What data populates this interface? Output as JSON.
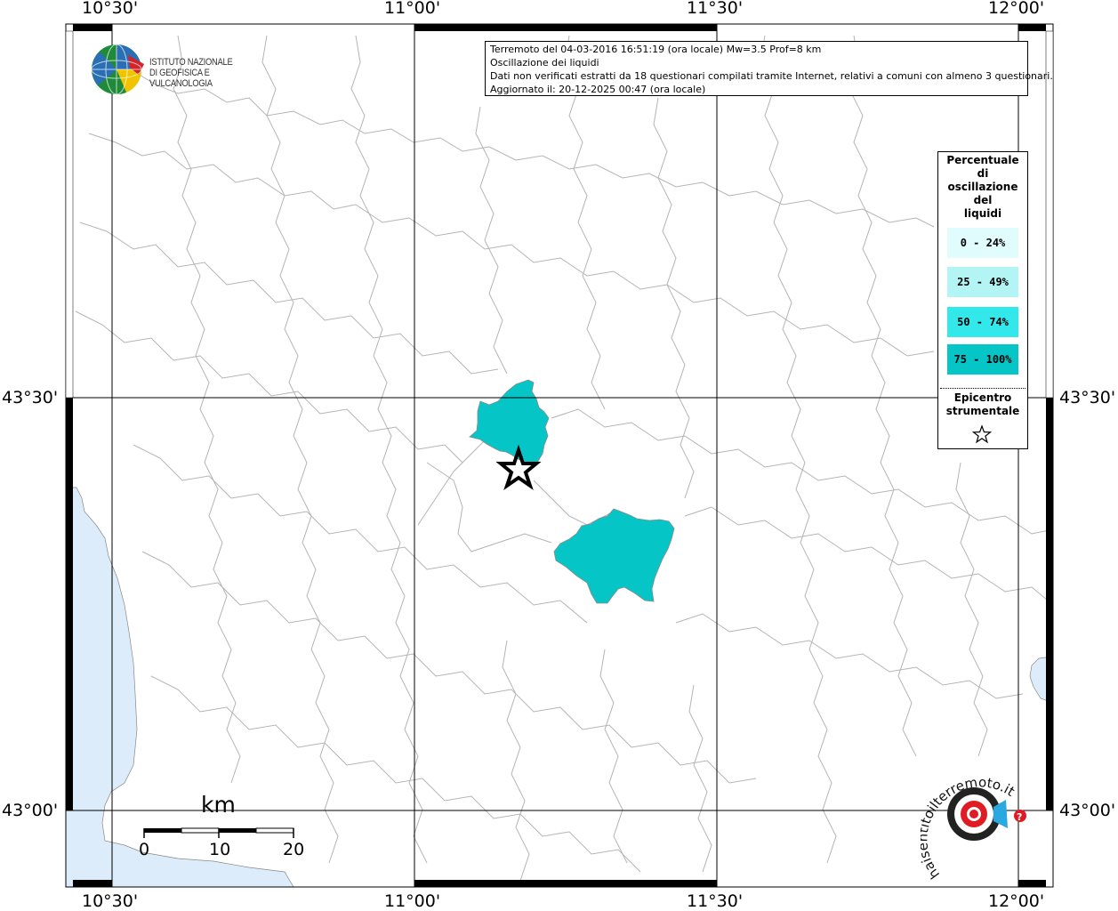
{
  "header": {
    "line1": "Terremoto del 04-03-2016 16:51:19 (ora locale) Mw=3.5 Prof=8 km",
    "line2": "Oscillazione dei liquidi",
    "line3": "Dati non verificati estratti da 18 questionari compilati tramite Internet, relativi a comuni con almeno 3 questionari.",
    "line4": "Aggiornato il: 20-12-2025 00:47 (ora locale)"
  },
  "axes": {
    "lon_labels": [
      "10°30'",
      "11°00'",
      "11°30'",
      "12°00'"
    ],
    "lat_labels": [
      "43°30'",
      "43°00'"
    ]
  },
  "legend": {
    "title": "Percentuale di oscillazione dei liquidi",
    "title_lines": [
      "Percentuale",
      "di",
      "oscillazione",
      "del",
      "liquidi"
    ],
    "classes": [
      {
        "label": "0 - 24%",
        "color": "#e0fcfc"
      },
      {
        "label": "25 - 49%",
        "color": "#b3f5f5"
      },
      {
        "label": "50 - 74%",
        "color": "#33e8ea"
      },
      {
        "label": "75 - 100%",
        "color": "#06c5c7"
      }
    ],
    "epicenter_lines": [
      "Epicentro",
      "strumentale"
    ]
  },
  "scale_bar": {
    "unit": "km",
    "ticks": [
      "0",
      "10",
      "20"
    ]
  },
  "logos": {
    "ingv_line1": "ISTITUTO NAZIONALE",
    "ingv_line2": "DI GEOFISICA E VULCANOLOGIA",
    "hsit_text": "haisentitoilterremoto.it"
  },
  "colors": {
    "sea": "#dcecfa",
    "municipality_border": "#b4b4b4",
    "grid": "#000000",
    "affected_fill": "#06c5c7"
  }
}
